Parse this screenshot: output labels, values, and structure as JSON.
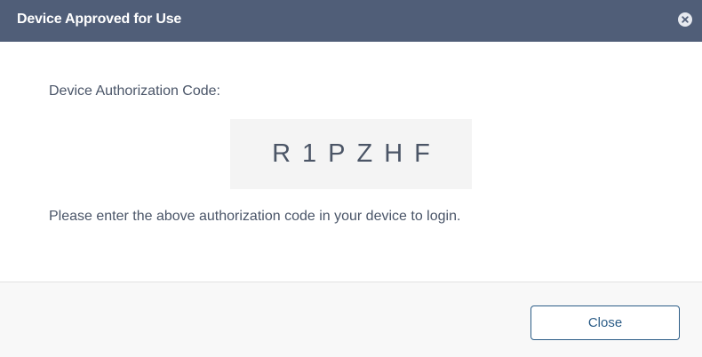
{
  "dialog": {
    "title": "Device Approved for Use",
    "close_icon": "close-circle-icon"
  },
  "content": {
    "code_label": "Device Authorization Code:",
    "code": "R1PZHF",
    "instructions": "Please enter the above authorization code in your device to login."
  },
  "footer": {
    "close_label": "Close"
  },
  "colors": {
    "titlebar": "#505e78",
    "accent": "#2c5d87",
    "code_bg": "#f4f4f4"
  }
}
